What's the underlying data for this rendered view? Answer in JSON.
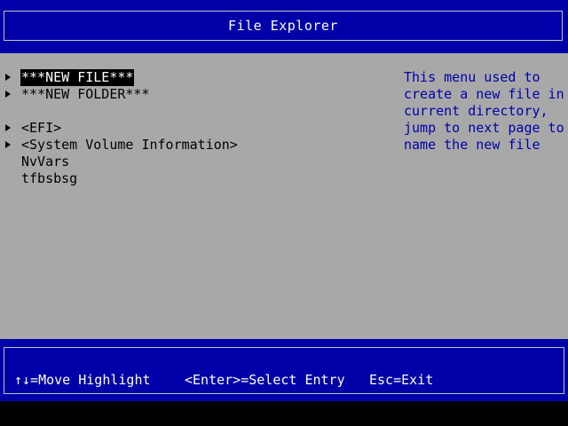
{
  "header": {
    "title": "File Explorer"
  },
  "entries": [
    {
      "label": "***NEW FILE***",
      "has_arrow": true,
      "selected": true
    },
    {
      "label": "***NEW FOLDER***",
      "has_arrow": true,
      "selected": false
    },
    {
      "label": "<EFI>",
      "has_arrow": true,
      "selected": false
    },
    {
      "label": "<System Volume Information>",
      "has_arrow": true,
      "selected": false
    },
    {
      "label": "NvVars",
      "has_arrow": false,
      "selected": false
    },
    {
      "label": "tfbsbsg",
      "has_arrow": false,
      "selected": false
    }
  ],
  "help": {
    "lines": [
      "This menu used to",
      "create a new file in",
      "current directory,",
      "jump to next page to",
      "name the new file"
    ]
  },
  "footer": {
    "move": "↑↓=Move Highlight",
    "enter": "<Enter>=Select Entry",
    "esc": "Esc=Exit"
  },
  "colors": {
    "band_blue": "#0000a8",
    "panel_grey": "#a8a8a8",
    "help_text_blue": "#0000a8",
    "highlight_bg": "#000000",
    "highlight_fg": "#ffffff"
  },
  "icons": {
    "entry_arrow": "triangle-right-icon"
  }
}
